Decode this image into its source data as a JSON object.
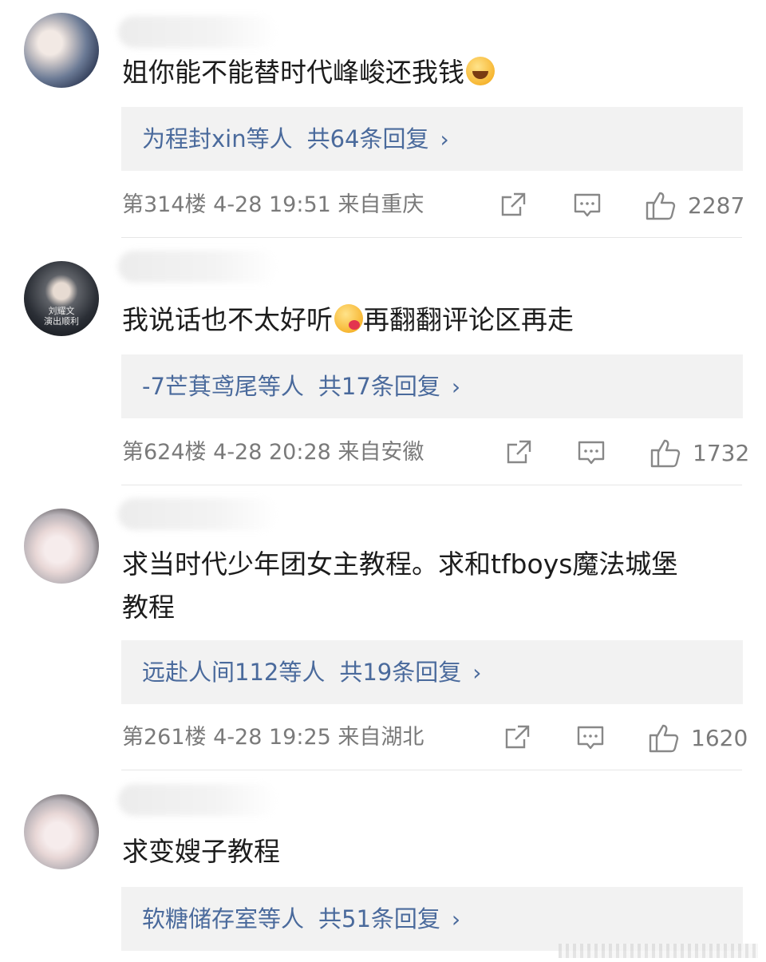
{
  "comments": [
    {
      "text": "姐你能不能替时代峰峻还我钱",
      "emoji": "laughing-crying-emoji",
      "reply_names": "为程封xin等人",
      "reply_count": "共64条回复",
      "floor": "第314楼",
      "time": "4-28 19:51",
      "location": "来自重庆",
      "likes": "2287"
    },
    {
      "text": "我说话也不太好听",
      "emoji": "blushing-face-emoji",
      "text_tail": "再翻翻评论区再走",
      "avatar_caption": "刘耀文\n演出顺利",
      "reply_names": "-7芒萁鸢尾等人",
      "reply_count": "共17条回复",
      "floor": "第624楼",
      "time": "4-28 20:28",
      "location": "来自安徽",
      "likes": "1732"
    },
    {
      "text": "求当时代少年团女主教程。求和tfboys魔法城堡",
      "text_line2": "教程",
      "reply_names": "远赴人间112等人",
      "reply_count": "共19条回复",
      "floor": "第261楼",
      "time": "4-28 19:25",
      "location": "来自湖北",
      "likes": "1620"
    },
    {
      "text": "求变嫂子教程",
      "reply_names": "软糖储存室等人",
      "reply_count": "共51条回复"
    }
  ],
  "icons": {
    "share": "share-icon",
    "comment": "comment-icon",
    "like": "thumbs-up-icon",
    "chevron": "chevron-right-icon"
  },
  "colors": {
    "link": "#4a6a9c",
    "meta": "#7a7a7a",
    "reply_bg": "#f2f2f2"
  }
}
